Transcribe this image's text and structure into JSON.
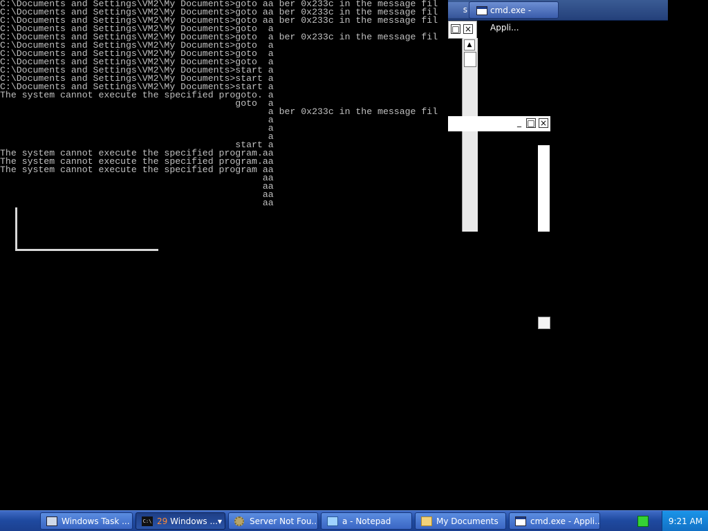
{
  "console": {
    "lines": [
      "C:\\Documents and Settings\\VM2\\My Documents>goto aa ber 0x233c in the message fil",
      "C:\\Documents and Settings\\VM2\\My Documents>goto aa ber 0x233c in the message fil",
      "C:\\Documents and Settings\\VM2\\My Documents>goto aa ber 0x233c in the message fil",
      "C:\\Documents and Settings\\VM2\\My Documents>goto  a",
      "C:\\Documents and Settings\\VM2\\My Documents>goto  a ber 0x233c in the message fil",
      "C:\\Documents and Settings\\VM2\\My Documents>goto  a",
      "C:\\Documents and Settings\\VM2\\My Documents>goto  a",
      "C:\\Documents and Settings\\VM2\\My Documents>goto  a",
      "C:\\Documents and Settings\\VM2\\My Documents>start a",
      "C:\\Documents and Settings\\VM2\\My Documents>start a",
      "C:\\Documents and Settings\\VM2\\My Documents>start a",
      "The system cannot execute the specified progoto. a",
      "                                           goto  a",
      "                                                 a ber 0x233c in the message fil",
      "                                                 a",
      "                                                 a",
      "                                                 a",
      "                                           start a",
      "The system cannot execute the specified program.aa",
      "The system cannot execute the specified program.aa",
      "The system cannot execute the specified program aa",
      "                                                aa",
      "                                                aa",
      "                                                aa",
      "                                                aa"
    ]
  },
  "top_strip": {
    "stub_text": "s",
    "button_label": "cmd.exe - Appli..."
  },
  "ghost_controls": {
    "restore": "□",
    "close": "×",
    "minimize": "_",
    "scroll_up": "▲"
  },
  "taskbar": {
    "items": [
      {
        "label": "Windows Task ...",
        "icon": "task-manager-icon"
      },
      {
        "count": "29",
        "label": "Windows ...",
        "icon": "console-icon"
      },
      {
        "label": "Server Not Fou...",
        "icon": "gear-icon"
      },
      {
        "label": "a - Notepad",
        "icon": "notepad-icon"
      },
      {
        "label": "My Documents",
        "icon": "folder-icon"
      },
      {
        "label": "cmd.exe - Appli...",
        "icon": "cmd-icon"
      }
    ],
    "clock": "9:21 AM",
    "tray_icon": "network-status-icon"
  }
}
